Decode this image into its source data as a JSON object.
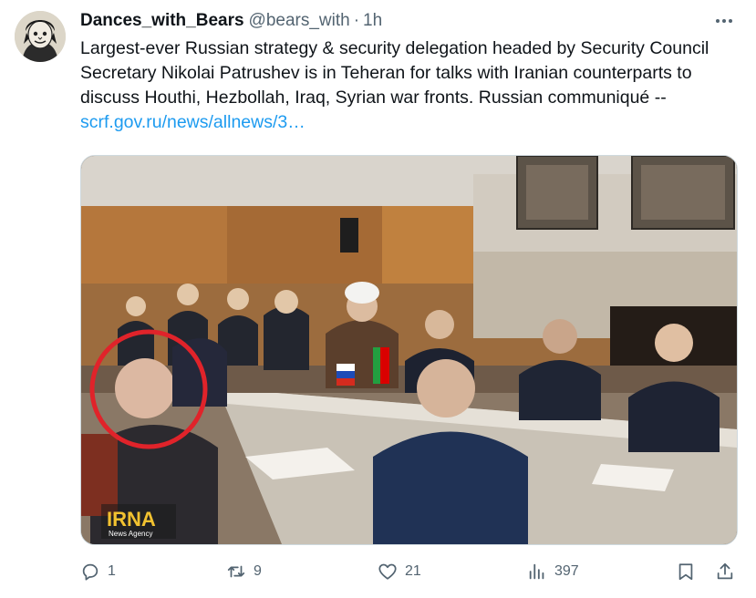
{
  "author": {
    "display_name": "Dances_with_Bears",
    "handle": "@bears_with",
    "separator": "·",
    "time": "1h"
  },
  "tweet": {
    "text": "Largest-ever Russian strategy & security delegation headed by Security Council Secretary Nikolai Patrushev is in Teheran for talks with Iranian counterparts to discuss Houthi, Hezbollah, Iraq, Syrian war fronts. Russian communiqué -- ",
    "link_text": "scrf.gov.ru/news/allnews/3…"
  },
  "media": {
    "watermark_logo": "IRNA",
    "watermark_sub": "News Agency",
    "highlight_color": "#e0232a"
  },
  "actions": {
    "replies": "1",
    "reposts": "9",
    "likes": "21",
    "views": "397"
  },
  "icons": [
    "more-icon",
    "reply-icon",
    "repost-icon",
    "like-icon",
    "views-icon",
    "bookmark-icon",
    "share-icon"
  ],
  "colors": {
    "link": "#1d9bf0",
    "secondary_text": "#536471",
    "primary_text": "#0f1419"
  }
}
